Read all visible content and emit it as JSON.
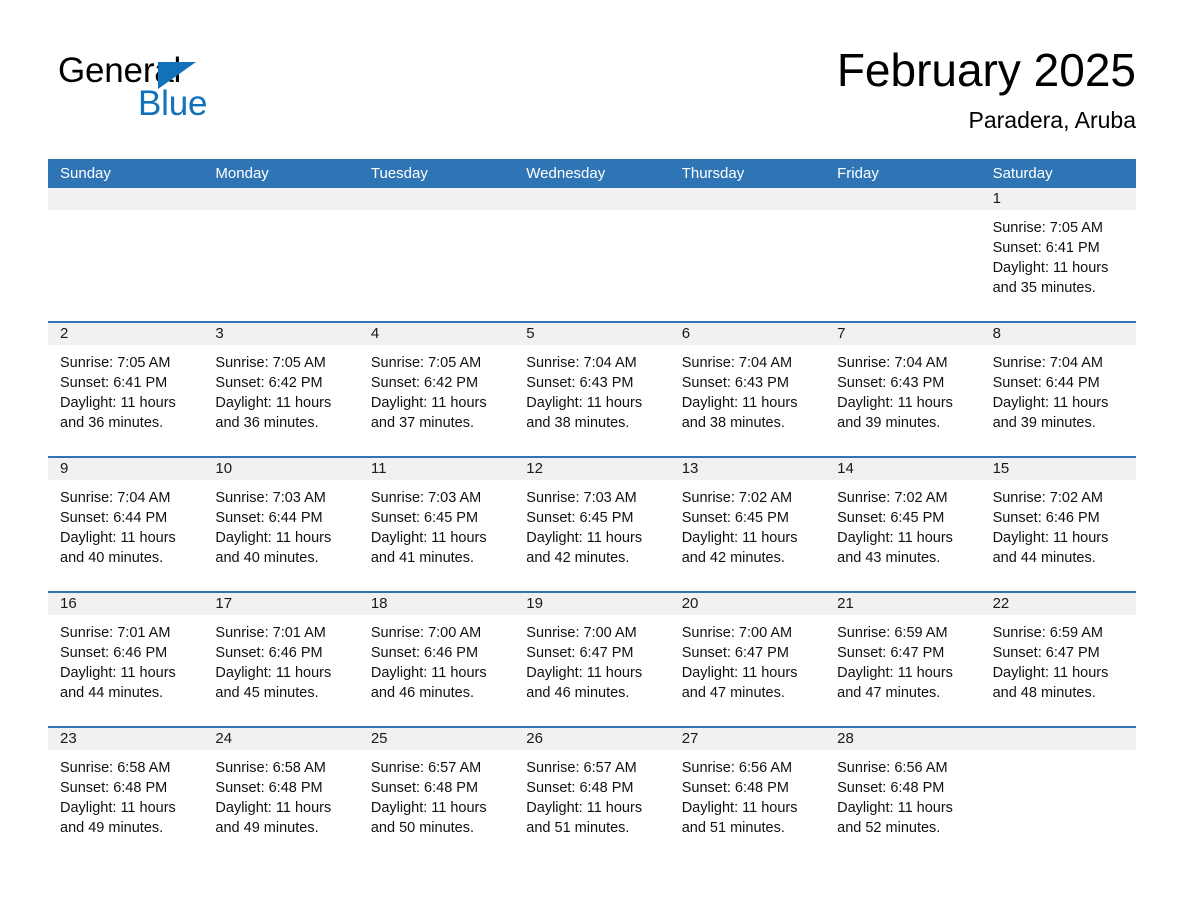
{
  "brand": {
    "name_top": "General",
    "name_bottom": "Blue",
    "accent_color": "#1172ba"
  },
  "header": {
    "title": "February 2025",
    "location": "Paradera, Aruba"
  },
  "calendar": {
    "header_color": "#2f75b5",
    "band_color": "#f1f1f1",
    "weekdays": [
      "Sunday",
      "Monday",
      "Tuesday",
      "Wednesday",
      "Thursday",
      "Friday",
      "Saturday"
    ],
    "weeks": [
      [
        {
          "day": "",
          "sunrise": "",
          "sunset": "",
          "daylight": ""
        },
        {
          "day": "",
          "sunrise": "",
          "sunset": "",
          "daylight": ""
        },
        {
          "day": "",
          "sunrise": "",
          "sunset": "",
          "daylight": ""
        },
        {
          "day": "",
          "sunrise": "",
          "sunset": "",
          "daylight": ""
        },
        {
          "day": "",
          "sunrise": "",
          "sunset": "",
          "daylight": ""
        },
        {
          "day": "",
          "sunrise": "",
          "sunset": "",
          "daylight": ""
        },
        {
          "day": "1",
          "sunrise": "Sunrise: 7:05 AM",
          "sunset": "Sunset: 6:41 PM",
          "daylight": "Daylight: 11 hours and 35 minutes."
        }
      ],
      [
        {
          "day": "2",
          "sunrise": "Sunrise: 7:05 AM",
          "sunset": "Sunset: 6:41 PM",
          "daylight": "Daylight: 11 hours and 36 minutes."
        },
        {
          "day": "3",
          "sunrise": "Sunrise: 7:05 AM",
          "sunset": "Sunset: 6:42 PM",
          "daylight": "Daylight: 11 hours and 36 minutes."
        },
        {
          "day": "4",
          "sunrise": "Sunrise: 7:05 AM",
          "sunset": "Sunset: 6:42 PM",
          "daylight": "Daylight: 11 hours and 37 minutes."
        },
        {
          "day": "5",
          "sunrise": "Sunrise: 7:04 AM",
          "sunset": "Sunset: 6:43 PM",
          "daylight": "Daylight: 11 hours and 38 minutes."
        },
        {
          "day": "6",
          "sunrise": "Sunrise: 7:04 AM",
          "sunset": "Sunset: 6:43 PM",
          "daylight": "Daylight: 11 hours and 38 minutes."
        },
        {
          "day": "7",
          "sunrise": "Sunrise: 7:04 AM",
          "sunset": "Sunset: 6:43 PM",
          "daylight": "Daylight: 11 hours and 39 minutes."
        },
        {
          "day": "8",
          "sunrise": "Sunrise: 7:04 AM",
          "sunset": "Sunset: 6:44 PM",
          "daylight": "Daylight: 11 hours and 39 minutes."
        }
      ],
      [
        {
          "day": "9",
          "sunrise": "Sunrise: 7:04 AM",
          "sunset": "Sunset: 6:44 PM",
          "daylight": "Daylight: 11 hours and 40 minutes."
        },
        {
          "day": "10",
          "sunrise": "Sunrise: 7:03 AM",
          "sunset": "Sunset: 6:44 PM",
          "daylight": "Daylight: 11 hours and 40 minutes."
        },
        {
          "day": "11",
          "sunrise": "Sunrise: 7:03 AM",
          "sunset": "Sunset: 6:45 PM",
          "daylight": "Daylight: 11 hours and 41 minutes."
        },
        {
          "day": "12",
          "sunrise": "Sunrise: 7:03 AM",
          "sunset": "Sunset: 6:45 PM",
          "daylight": "Daylight: 11 hours and 42 minutes."
        },
        {
          "day": "13",
          "sunrise": "Sunrise: 7:02 AM",
          "sunset": "Sunset: 6:45 PM",
          "daylight": "Daylight: 11 hours and 42 minutes."
        },
        {
          "day": "14",
          "sunrise": "Sunrise: 7:02 AM",
          "sunset": "Sunset: 6:45 PM",
          "daylight": "Daylight: 11 hours and 43 minutes."
        },
        {
          "day": "15",
          "sunrise": "Sunrise: 7:02 AM",
          "sunset": "Sunset: 6:46 PM",
          "daylight": "Daylight: 11 hours and 44 minutes."
        }
      ],
      [
        {
          "day": "16",
          "sunrise": "Sunrise: 7:01 AM",
          "sunset": "Sunset: 6:46 PM",
          "daylight": "Daylight: 11 hours and 44 minutes."
        },
        {
          "day": "17",
          "sunrise": "Sunrise: 7:01 AM",
          "sunset": "Sunset: 6:46 PM",
          "daylight": "Daylight: 11 hours and 45 minutes."
        },
        {
          "day": "18",
          "sunrise": "Sunrise: 7:00 AM",
          "sunset": "Sunset: 6:46 PM",
          "daylight": "Daylight: 11 hours and 46 minutes."
        },
        {
          "day": "19",
          "sunrise": "Sunrise: 7:00 AM",
          "sunset": "Sunset: 6:47 PM",
          "daylight": "Daylight: 11 hours and 46 minutes."
        },
        {
          "day": "20",
          "sunrise": "Sunrise: 7:00 AM",
          "sunset": "Sunset: 6:47 PM",
          "daylight": "Daylight: 11 hours and 47 minutes."
        },
        {
          "day": "21",
          "sunrise": "Sunrise: 6:59 AM",
          "sunset": "Sunset: 6:47 PM",
          "daylight": "Daylight: 11 hours and 47 minutes."
        },
        {
          "day": "22",
          "sunrise": "Sunrise: 6:59 AM",
          "sunset": "Sunset: 6:47 PM",
          "daylight": "Daylight: 11 hours and 48 minutes."
        }
      ],
      [
        {
          "day": "23",
          "sunrise": "Sunrise: 6:58 AM",
          "sunset": "Sunset: 6:48 PM",
          "daylight": "Daylight: 11 hours and 49 minutes."
        },
        {
          "day": "24",
          "sunrise": "Sunrise: 6:58 AM",
          "sunset": "Sunset: 6:48 PM",
          "daylight": "Daylight: 11 hours and 49 minutes."
        },
        {
          "day": "25",
          "sunrise": "Sunrise: 6:57 AM",
          "sunset": "Sunset: 6:48 PM",
          "daylight": "Daylight: 11 hours and 50 minutes."
        },
        {
          "day": "26",
          "sunrise": "Sunrise: 6:57 AM",
          "sunset": "Sunset: 6:48 PM",
          "daylight": "Daylight: 11 hours and 51 minutes."
        },
        {
          "day": "27",
          "sunrise": "Sunrise: 6:56 AM",
          "sunset": "Sunset: 6:48 PM",
          "daylight": "Daylight: 11 hours and 51 minutes."
        },
        {
          "day": "28",
          "sunrise": "Sunrise: 6:56 AM",
          "sunset": "Sunset: 6:48 PM",
          "daylight": "Daylight: 11 hours and 52 minutes."
        },
        {
          "day": "",
          "sunrise": "",
          "sunset": "",
          "daylight": ""
        }
      ]
    ]
  }
}
